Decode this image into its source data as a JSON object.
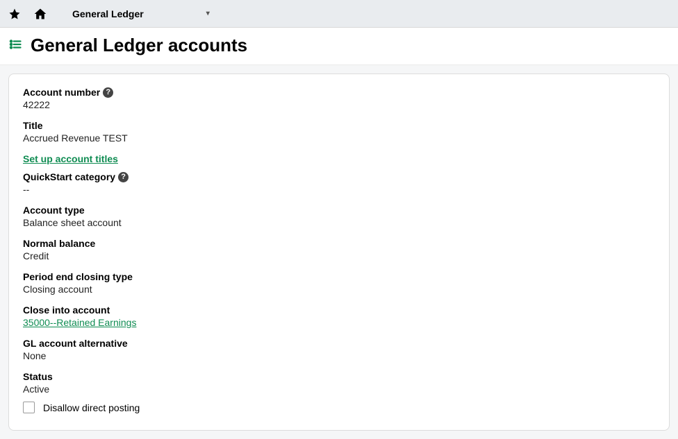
{
  "topbar": {
    "module_label": "General Ledger"
  },
  "page": {
    "title": "General Ledger accounts"
  },
  "account": {
    "account_number_label": "Account number",
    "account_number_value": "42222",
    "title_label": "Title",
    "title_value": "Accrued Revenue TEST",
    "setup_titles_link": "Set up account titles",
    "quickstart_label": "QuickStart category",
    "quickstart_value": "--",
    "account_type_label": "Account type",
    "account_type_value": "Balance sheet account",
    "normal_balance_label": "Normal balance",
    "normal_balance_value": "Credit",
    "period_end_label": "Period end closing type",
    "period_end_value": "Closing account",
    "close_into_label": "Close into account",
    "close_into_value": "35000--Retained Earnings",
    "gl_alt_label": "GL account alternative",
    "gl_alt_value": "None",
    "status_label": "Status",
    "status_value": "Active",
    "disallow_label": "Disallow direct posting"
  }
}
